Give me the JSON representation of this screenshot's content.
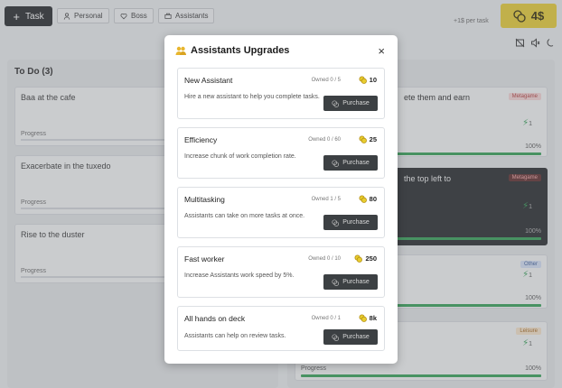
{
  "topbar": {
    "task_button": "Task",
    "chips": [
      "Personal",
      "Boss",
      "Assistants"
    ],
    "per_task": "+1$ per task",
    "money": "4$"
  },
  "board": {
    "todo_title": "To Do (3)",
    "todo_cards": [
      {
        "title": "Baa at the cafe",
        "progress_label": "Progress",
        "progress": 0
      },
      {
        "title": "Exacerbate in the tuxedo",
        "progress_label": "Progress",
        "progress": 0
      },
      {
        "title": "Rise to the duster",
        "progress_label": "Progress",
        "progress": 0
      }
    ],
    "right_cards": [
      {
        "title": "ete them and earn",
        "badge": "Metagame",
        "bolt": "1",
        "percent": "100%"
      },
      {
        "title": "the top left to",
        "badge": "Metagame",
        "bolt": "1",
        "percent": "100%"
      },
      {
        "title": "",
        "badge": "Other",
        "bolt": "1",
        "percent": "100%"
      },
      {
        "title": "",
        "badge": "Leisure",
        "bolt": "1",
        "percent": "100%",
        "progress_label": "Progress"
      }
    ]
  },
  "modal": {
    "title": "Assistants Upgrades",
    "close_label": "×",
    "purchase_label": "Purchase",
    "upgrades": [
      {
        "name": "New Assistant",
        "owned": "Owned 0 / 5",
        "cost": "10",
        "desc": "Hire a new assistant to help you complete tasks."
      },
      {
        "name": "Efficiency",
        "owned": "Owned 0 / 60",
        "cost": "25",
        "desc": "Increase chunk of work completion rate."
      },
      {
        "name": "Multitasking",
        "owned": "Owned 1 / 5",
        "cost": "80",
        "desc": "Assistants can take on more tasks at once."
      },
      {
        "name": "Fast worker",
        "owned": "Owned 0 / 10",
        "cost": "250",
        "desc": "Increase Assistants work speed by 5%."
      },
      {
        "name": "All hands on deck",
        "owned": "Owned 0 / 1",
        "cost": "8k",
        "desc": "Assistants can help on review tasks."
      }
    ]
  },
  "colors": {
    "accent": "#e8cd2e",
    "dark": "#1f2326",
    "green": "#2e9e52"
  },
  "icons": [
    "plus-icon",
    "person-icon",
    "heart-icon",
    "assistants-icon",
    "money-icon",
    "no-image-icon",
    "mute-icon",
    "moon-icon",
    "close-icon",
    "coin-icon",
    "bolt-icon"
  ]
}
